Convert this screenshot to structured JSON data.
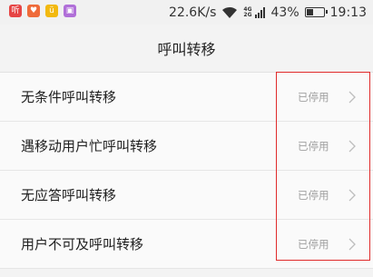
{
  "status_bar": {
    "apps": [
      {
        "icon": "music-app-icon",
        "glyph": "听",
        "color": "#e64545"
      },
      {
        "icon": "mail-app-icon",
        "glyph": "♥",
        "color": "#ef6b3a"
      },
      {
        "icon": "notes-app-icon",
        "glyph": "ü",
        "color": "#f2b90f"
      },
      {
        "icon": "gallery-app-icon",
        "glyph": "▣",
        "color": "#b06fd8"
      }
    ],
    "net_speed": "22.6K/s",
    "net_tag_top": "4G",
    "net_tag_bottom": "2G",
    "battery": "43%",
    "battery_level": 0.43,
    "time": "19:13"
  },
  "title": "呼叫转移",
  "rows": [
    {
      "label": "无条件呼叫转移",
      "status": "已停用"
    },
    {
      "label": "遇移动用户忙呼叫转移",
      "status": "已停用"
    },
    {
      "label": "无应答呼叫转移",
      "status": "已停用"
    },
    {
      "label": "用户不可及呼叫转移",
      "status": "已停用"
    }
  ],
  "colors": {
    "highlight_box": "#e02b2b",
    "status_text": "#a0a0a0"
  }
}
